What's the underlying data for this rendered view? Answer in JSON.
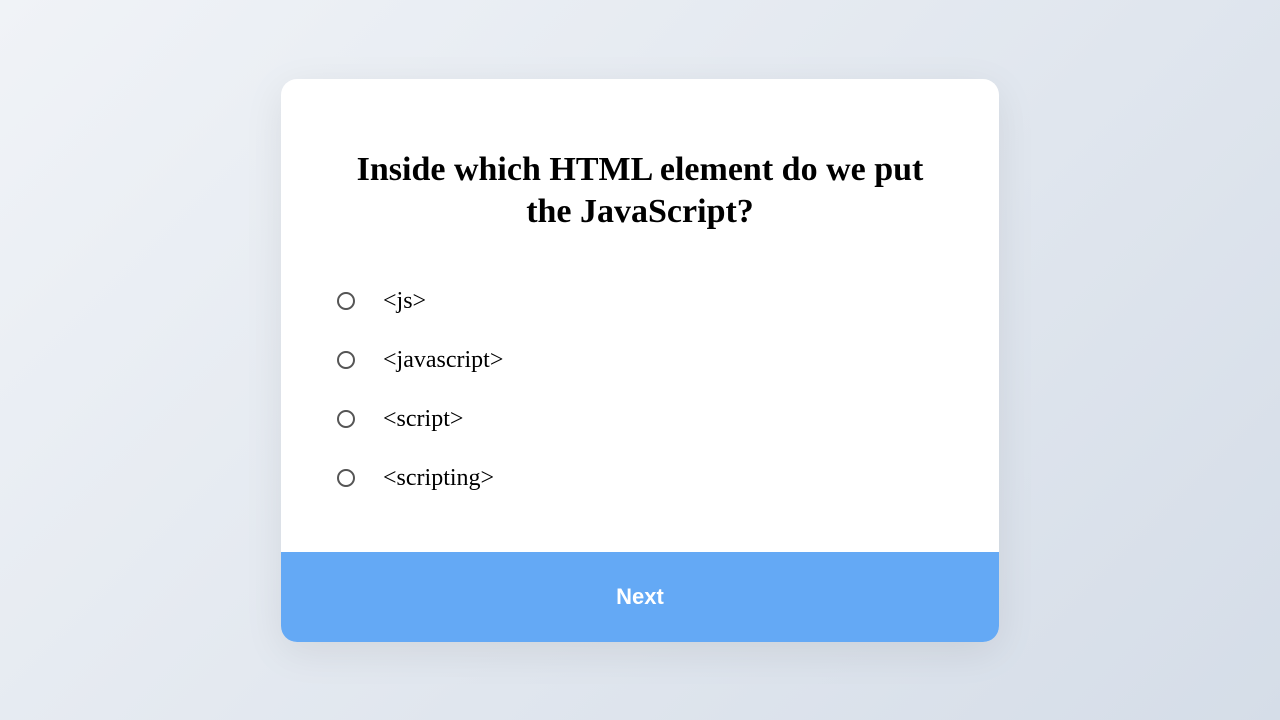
{
  "quiz": {
    "question": "Inside which HTML element do we put the JavaScript?",
    "options": [
      {
        "label": "<js>"
      },
      {
        "label": "<javascript>"
      },
      {
        "label": "<script>"
      },
      {
        "label": "<scripting>"
      }
    ],
    "next_label": "Next"
  },
  "colors": {
    "accent": "#64a9f5"
  }
}
